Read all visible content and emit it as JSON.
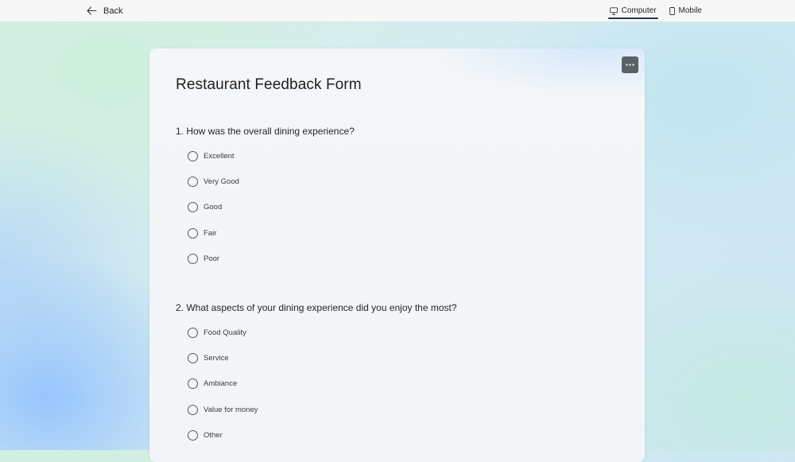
{
  "topbar": {
    "back_label": "Back",
    "view_tabs": [
      {
        "label": "Computer",
        "icon": "monitor-icon",
        "active": true
      },
      {
        "label": "Mobile",
        "icon": "phone-icon",
        "active": false
      }
    ]
  },
  "form": {
    "title": "Restaurant Feedback Form",
    "more_button_icon": "more-horizontal-icon",
    "questions": [
      {
        "text": "1. How was the overall dining experience?",
        "options": [
          "Excellent",
          "Very Good",
          "Good",
          "Fair",
          "Poor"
        ]
      },
      {
        "text": "2. What aspects of your dining experience did you enjoy the most?",
        "options": [
          "Food Quality",
          "Service",
          "Ambiance",
          "Value for money",
          "Other"
        ]
      }
    ]
  },
  "colors": {
    "active_tab_underline": "#1f3b4d",
    "more_button_bg": "#5b6166",
    "radio_border": "#555a5e"
  }
}
